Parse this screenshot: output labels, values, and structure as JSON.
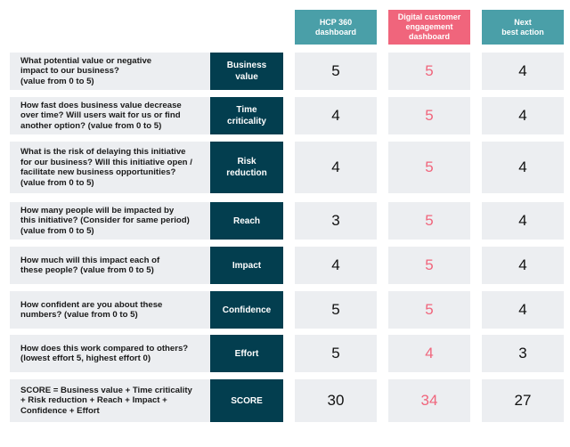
{
  "colors": {
    "teal_header": "#4a9fa8",
    "pink_header": "#f0657c",
    "label_bg": "#033e4f",
    "cell_bg": "#eceef1",
    "highlight_value": "#f0657c"
  },
  "columns": [
    {
      "name": "HCP 360\ndashboard",
      "highlight": false
    },
    {
      "name": "Digital customer\nengagement\ndashboard",
      "highlight": true
    },
    {
      "name": "Next\nbest action",
      "highlight": false
    }
  ],
  "rows": [
    {
      "question": "What potential value or negative\nimpact to our business?\n(value from 0 to 5)",
      "label": "Business\nvalue",
      "values": [
        "5",
        "5",
        "4"
      ]
    },
    {
      "question": "How fast does business value decrease\nover time? Will users wait for us or find\nanother option? (value from 0 to 5)",
      "label": "Time\ncriticality",
      "values": [
        "4",
        "5",
        "4"
      ]
    },
    {
      "question": "What is the risk of delaying this initiative\nfor our business? Will this initiative open /\nfacilitate new business opportunities?\n(value from 0 to 5)",
      "label": "Risk\nreduction",
      "values": [
        "4",
        "5",
        "4"
      ]
    },
    {
      "question": "How many people will be impacted by\nthis initiative? (Consider for same period)\n(value from 0 to 5)",
      "label": "Reach",
      "values": [
        "3",
        "5",
        "4"
      ]
    },
    {
      "question": "How much will this impact each of\nthese people? (value from 0 to 5)",
      "label": "Impact",
      "values": [
        "4",
        "5",
        "4"
      ]
    },
    {
      "question": "How confident are you about these\nnumbers? (value from 0 to 5)",
      "label": "Confidence",
      "values": [
        "5",
        "5",
        "4"
      ]
    },
    {
      "question": "How does this work compared to others?\n(lowest effort 5, highest effort 0)",
      "label": "Effort",
      "values": [
        "5",
        "4",
        "3"
      ]
    },
    {
      "question": "SCORE = Business value + Time criticality\n+ Risk reduction + Reach + Impact +\nConfidence + Effort",
      "label": "SCORE",
      "values": [
        "30",
        "34",
        "27"
      ]
    }
  ]
}
